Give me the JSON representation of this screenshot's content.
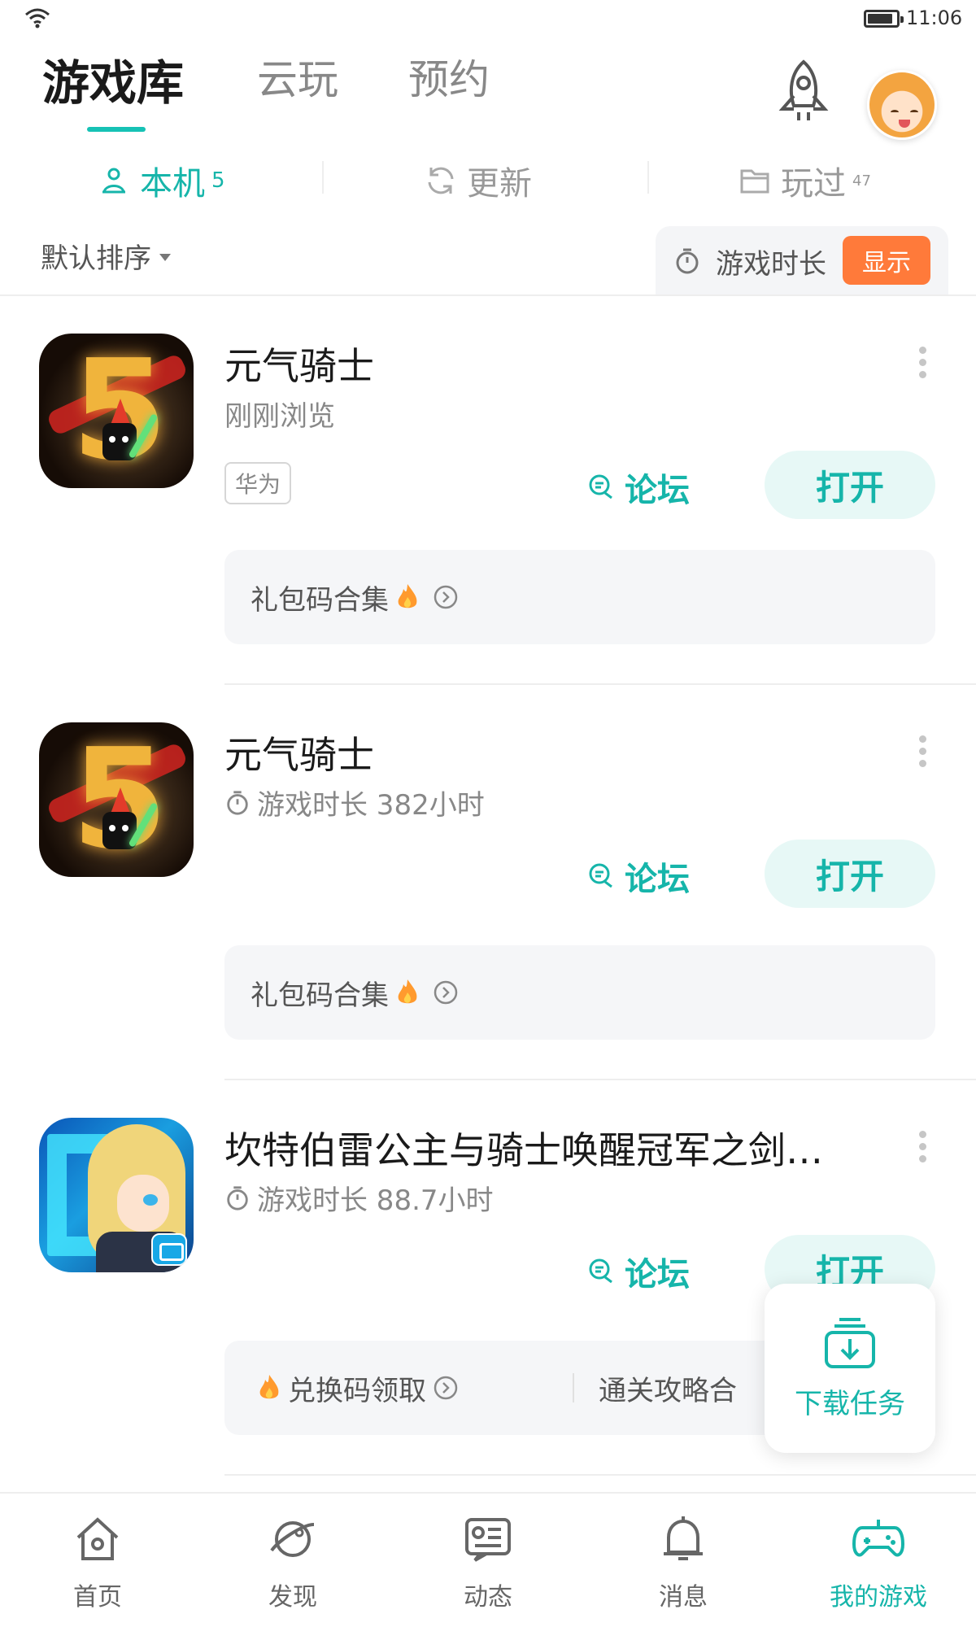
{
  "status_bar": {
    "time": "11:06"
  },
  "top_tabs": [
    {
      "label": "游戏库",
      "active": true
    },
    {
      "label": "云玩",
      "active": false
    },
    {
      "label": "预约",
      "active": false
    }
  ],
  "sub_tabs": [
    {
      "label": "本机",
      "count": "5",
      "icon": "phone-user-icon",
      "active": true
    },
    {
      "label": "更新",
      "count": "",
      "icon": "refresh-icon",
      "active": false
    },
    {
      "label": "玩过",
      "count": "47",
      "icon": "folder-icon",
      "active": false
    }
  ],
  "sort": {
    "label": "默认排序"
  },
  "playtime_toggle": {
    "label": "游戏时长",
    "button": "显示"
  },
  "games": [
    {
      "title": "元气骑士",
      "subtitle": "刚刚浏览",
      "tag": "华为",
      "forum": "论坛",
      "open": "打开",
      "promos": [
        "礼包码合集"
      ]
    },
    {
      "title": "元气骑士",
      "subtitle": "游戏时长 382小时",
      "forum": "论坛",
      "open": "打开",
      "promos": [
        "礼包码合集"
      ]
    },
    {
      "title": "坎特伯雷公主与骑士唤醒冠军之剑…",
      "subtitle": "游戏时长 88.7小时",
      "forum": "论坛",
      "open": "打开",
      "promos": [
        "兑换码领取",
        "通关攻略合"
      ]
    }
  ],
  "download_float": {
    "label": "下载任务"
  },
  "bottom_nav": [
    {
      "label": "首页",
      "icon": "home-icon",
      "active": false
    },
    {
      "label": "发现",
      "icon": "planet-icon",
      "active": false
    },
    {
      "label": "动态",
      "icon": "feed-icon",
      "active": false
    },
    {
      "label": "消息",
      "icon": "bell-icon",
      "active": false
    },
    {
      "label": "我的游戏",
      "icon": "gamepad-icon",
      "active": true
    }
  ],
  "colors": {
    "accent": "#16b5aa",
    "orange": "#ff7a3a"
  }
}
